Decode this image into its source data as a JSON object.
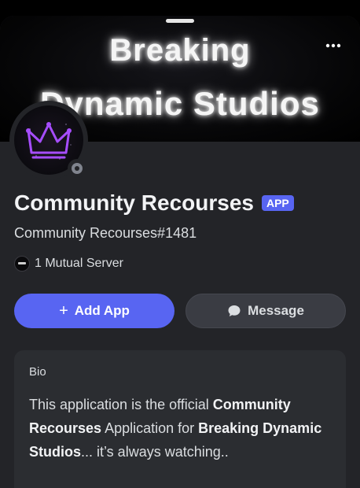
{
  "banner": {
    "line1": "Breaking",
    "line2": "Dynamic Studios"
  },
  "icons": {
    "more": "more-horizontal-icon",
    "crown": "crown-icon",
    "message": "chat-bubble-icon",
    "plus": "plus-icon"
  },
  "profile": {
    "name": "Community Recourses",
    "badge": "APP",
    "tag": "Community Recourses#1481",
    "mutual": "1 Mutual Server",
    "status": "offline"
  },
  "actions": {
    "add_app": "Add App",
    "message": "Message"
  },
  "bio": {
    "title": "Bio",
    "segments": [
      {
        "text": "This application is the official ",
        "bold": false
      },
      {
        "text": "Community Recourses",
        "bold": true
      },
      {
        "text": " Application for ",
        "bold": false
      },
      {
        "text": "Breaking Dynamic Studios",
        "bold": true
      },
      {
        "text": "... it’s always watching..",
        "bold": false
      }
    ]
  },
  "colors": {
    "accent": "#5865f2",
    "sheet_bg": "#232428",
    "card_bg": "#2b2d31",
    "status_offline": "#80848e"
  }
}
